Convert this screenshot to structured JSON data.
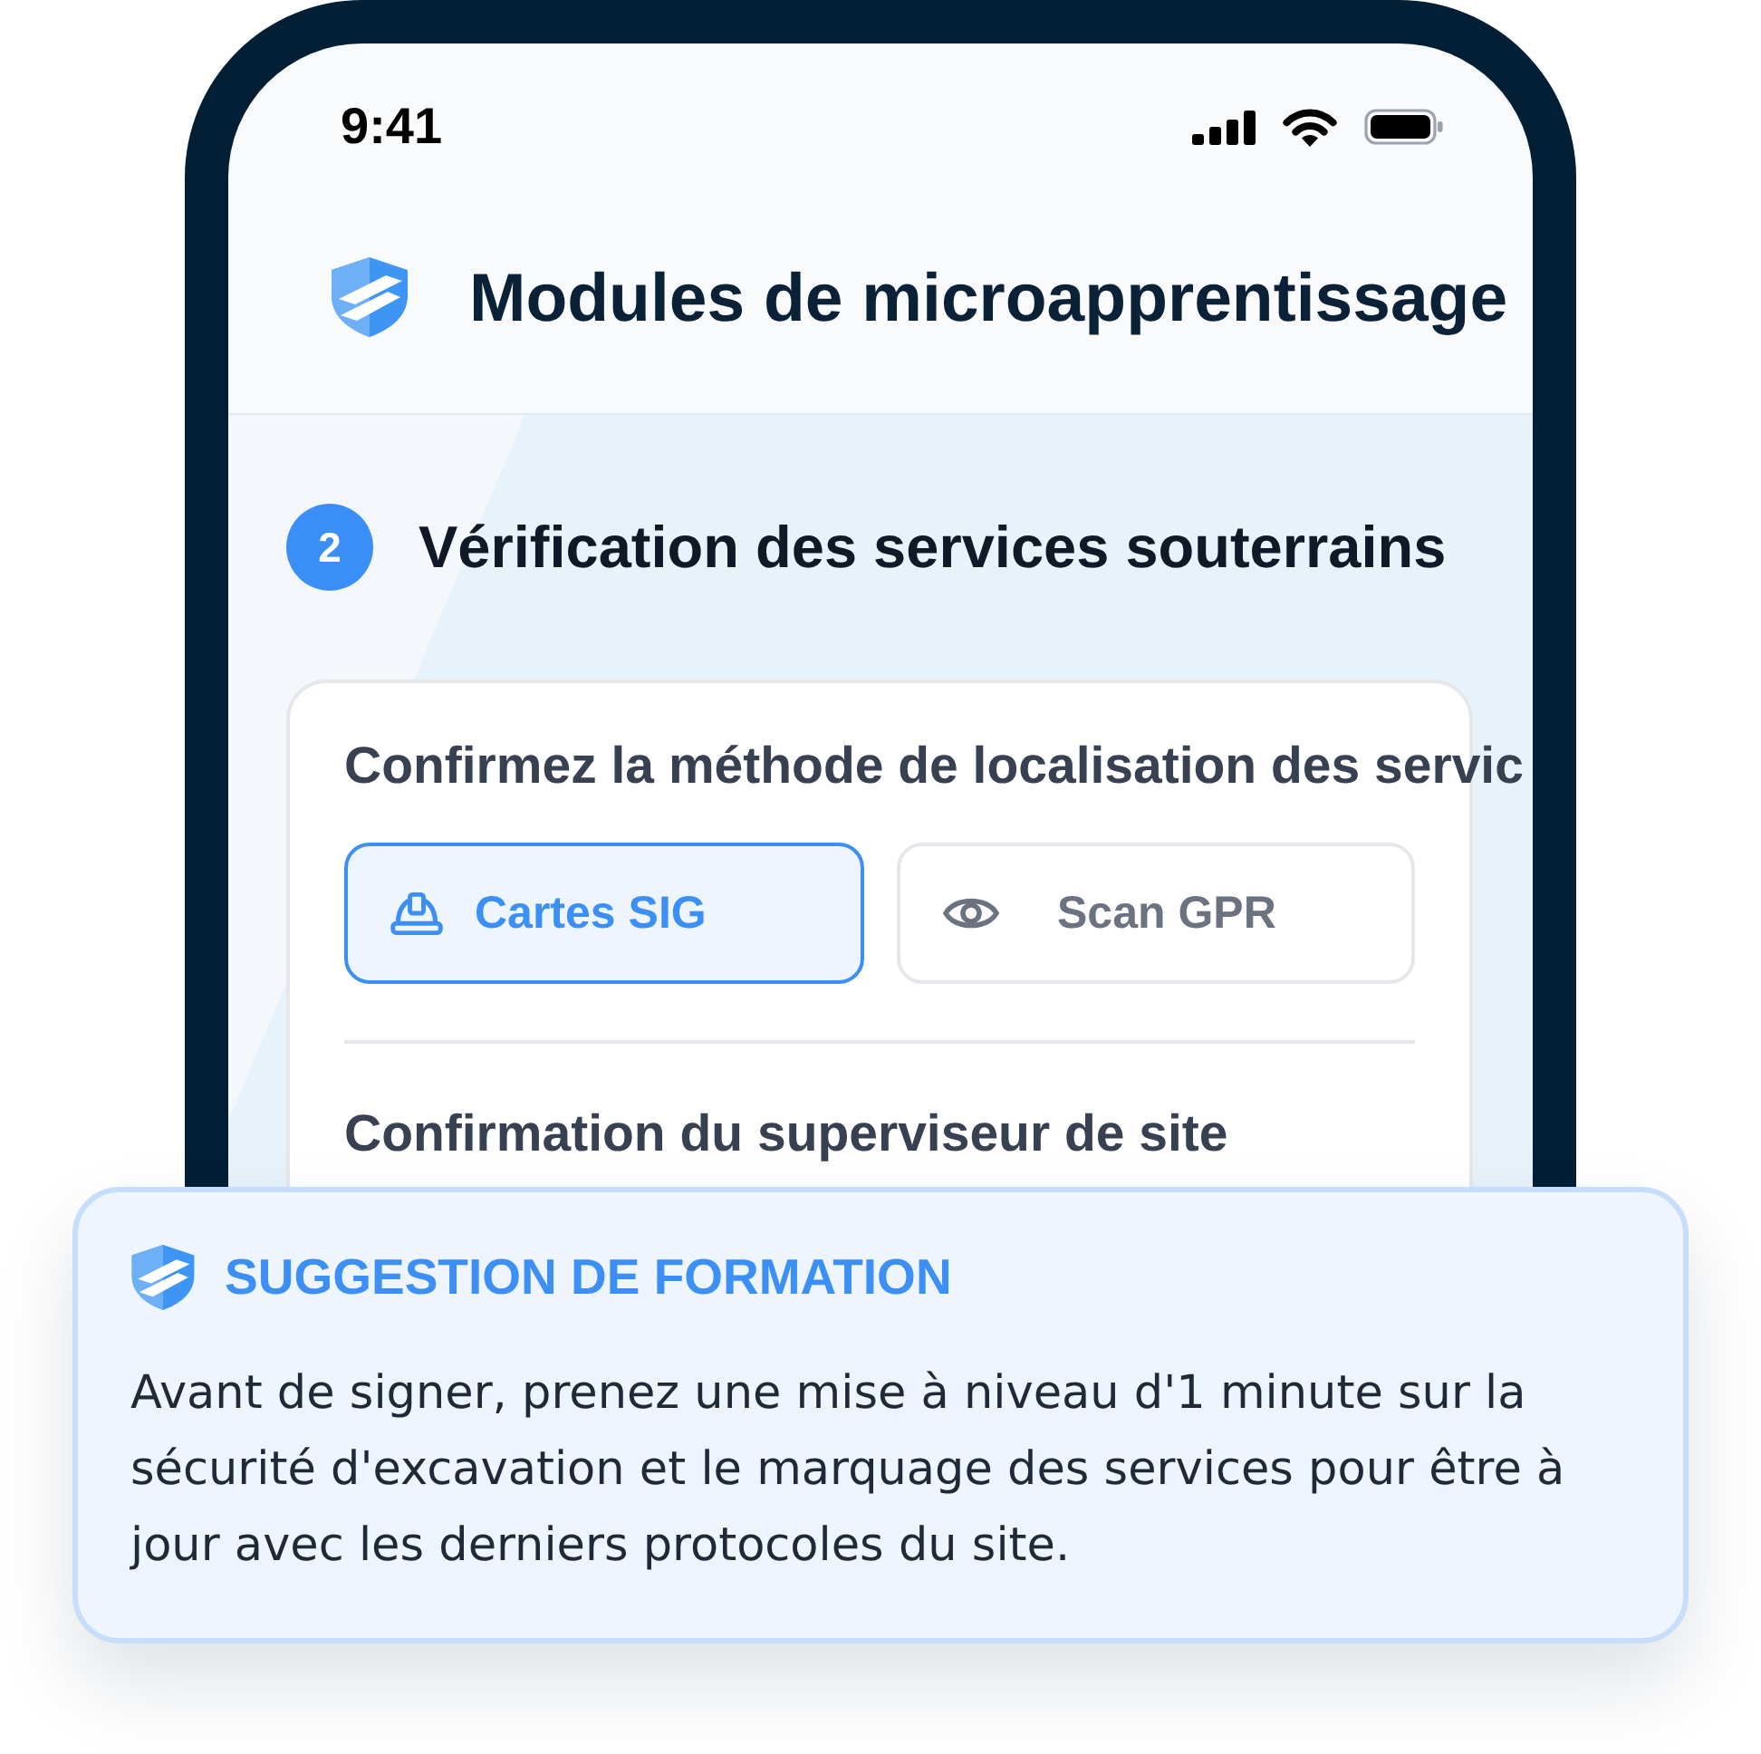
{
  "status_bar": {
    "time": "9:41"
  },
  "header": {
    "title": "Modules de microapprentissage"
  },
  "step": {
    "number": "2",
    "title": "Vérification des services souterrains"
  },
  "card": {
    "question": "Confirmez la méthode de localisation des servic",
    "options": [
      {
        "label": "Cartes SIG",
        "selected": true
      },
      {
        "label": "Scan GPR",
        "selected": false
      }
    ],
    "section_label": "Confirmation du superviseur de site"
  },
  "suggestion": {
    "title": "SUGGESTION DE FORMATION",
    "text": "Avant de signer, prenez une mise à niveau d'1 minute sur la sécurité d'excavation et le marquage des services pour être à jour avec les derniers protocoles du site."
  }
}
